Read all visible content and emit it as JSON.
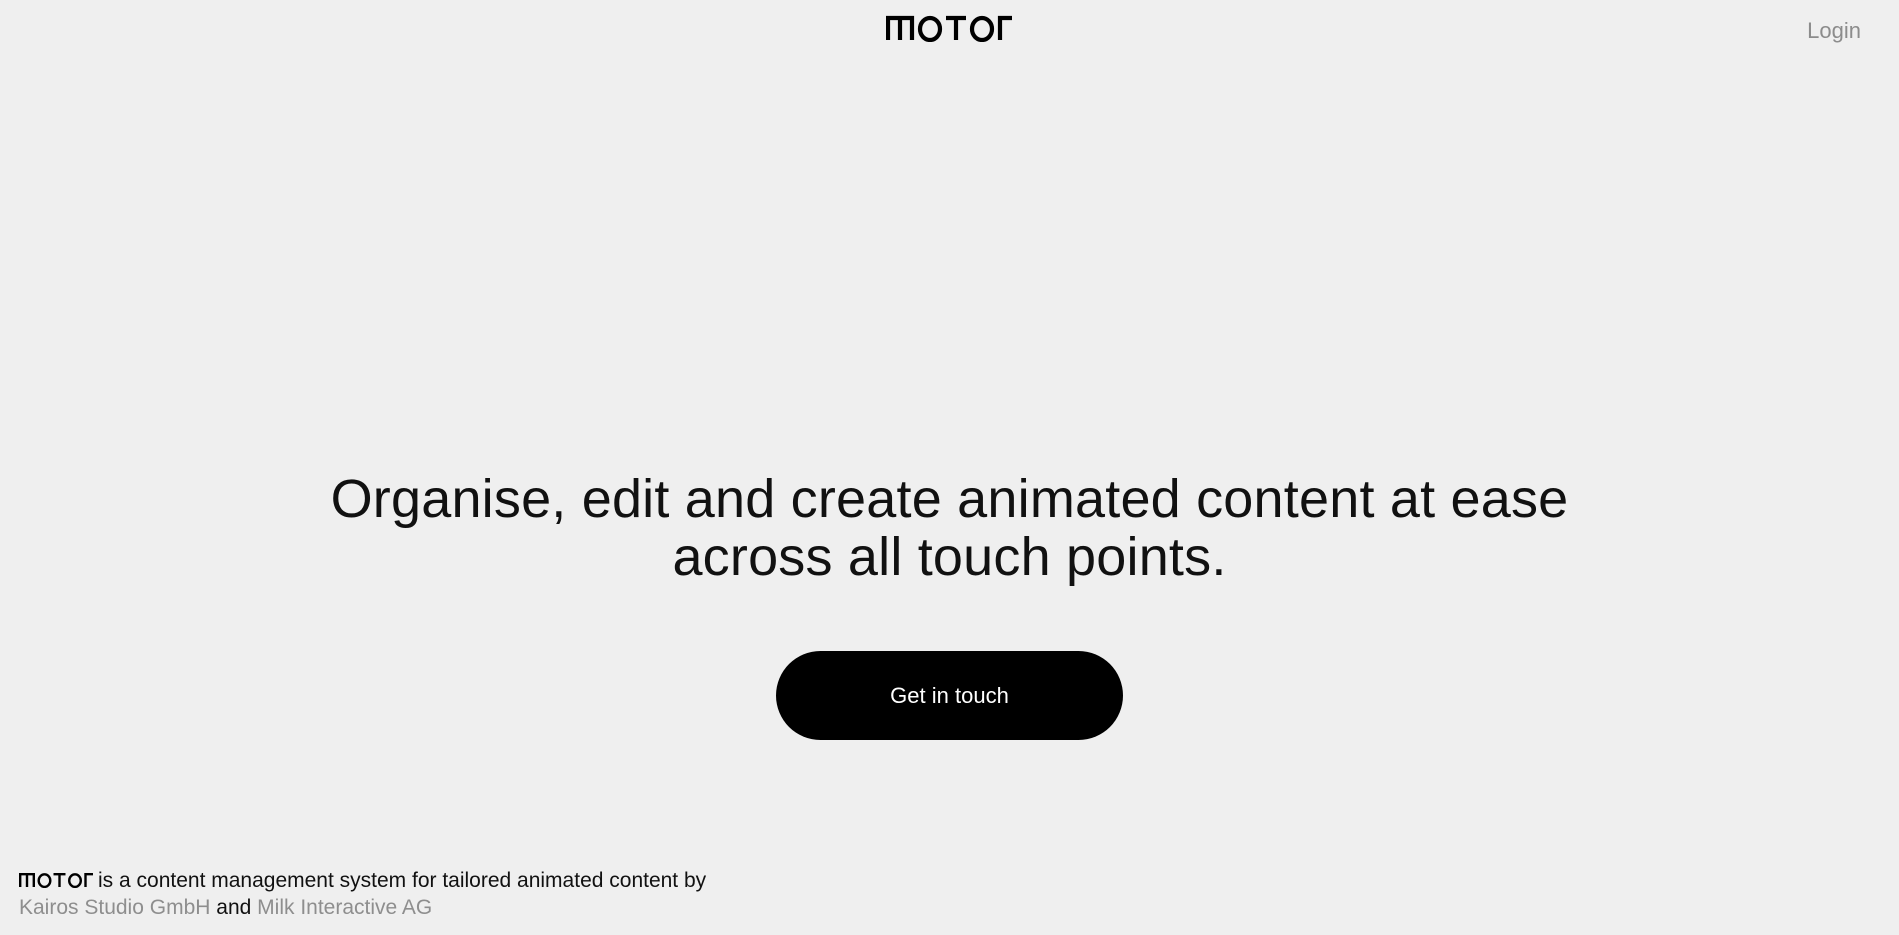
{
  "header": {
    "logo_text": "motor",
    "login_label": "Login"
  },
  "hero": {
    "headline_line1": "Organise, edit and create animated content at ease",
    "headline_line2": "across all touch points.",
    "cta_label": "Get in touch"
  },
  "footer": {
    "logo_text": "motor",
    "description": "is a content management system for tailored animated content by",
    "partner1": "Kairos Studio GmbH",
    "conjunction": "and",
    "partner2": "Milk Interactive AG"
  },
  "colors": {
    "background": "#efefef",
    "text": "#111111",
    "muted": "#8c8c8c",
    "button_bg": "#000000",
    "button_text": "#ffffff"
  }
}
